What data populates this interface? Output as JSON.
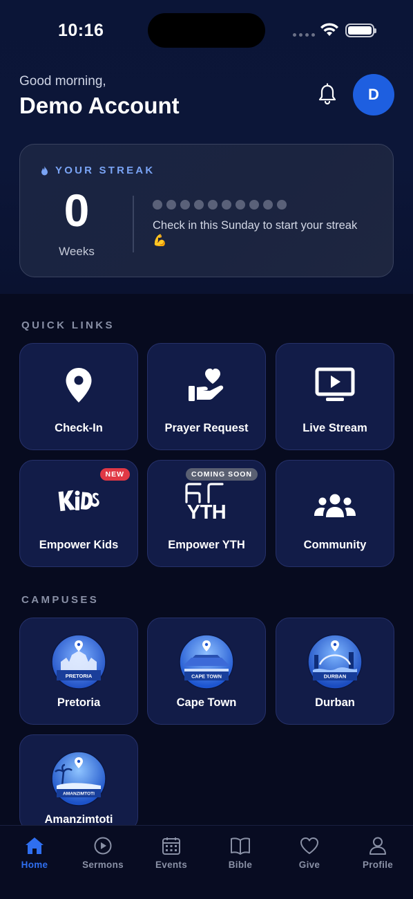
{
  "status_bar": {
    "time": "10:16"
  },
  "header": {
    "greeting": "Good morning,",
    "user_name": "Demo Account",
    "avatar_initial": "D"
  },
  "streak": {
    "title": "YOUR STREAK",
    "count": "0",
    "unit": "Weeks",
    "message": "Check in this Sunday to start your streak 💪",
    "dots_total": 10,
    "dots_filled": 0
  },
  "quick_links": {
    "title": "QUICK LINKS",
    "items": [
      {
        "label": "Check-In",
        "icon": "location-pin-icon"
      },
      {
        "label": "Prayer Request",
        "icon": "hand-heart-icon"
      },
      {
        "label": "Live Stream",
        "icon": "tv-play-icon"
      },
      {
        "label": "Empower Kids",
        "icon": "kids-logo-icon",
        "badge": "NEW"
      },
      {
        "label": "Empower YTH",
        "icon": "yth-logo-icon",
        "badge": "COMING SOON",
        "logo_text": "YTH"
      },
      {
        "label": "Community",
        "icon": "people-group-icon"
      }
    ]
  },
  "campuses": {
    "title": "CAMPUSES",
    "items": [
      {
        "label": "Pretoria",
        "emblem_text": "PRETORIA"
      },
      {
        "label": "Cape Town",
        "emblem_text": "CAPE TOWN"
      },
      {
        "label": "Durban",
        "emblem_text": "DURBAN"
      },
      {
        "label": "Amanzimtoti",
        "emblem_text": "AMANZIMTOTI"
      }
    ]
  },
  "nav": {
    "items": [
      {
        "label": "Home",
        "icon": "home-icon",
        "active": true
      },
      {
        "label": "Sermons",
        "icon": "play-circle-icon"
      },
      {
        "label": "Events",
        "icon": "calendar-icon"
      },
      {
        "label": "Bible",
        "icon": "open-book-icon"
      },
      {
        "label": "Give",
        "icon": "heart-icon"
      },
      {
        "label": "Profile",
        "icon": "person-icon"
      }
    ]
  },
  "colors": {
    "accent": "#2f6ff0",
    "tile_bg": "#121c48",
    "badge_new": "#e03845",
    "badge_soon": "#5a6072"
  }
}
